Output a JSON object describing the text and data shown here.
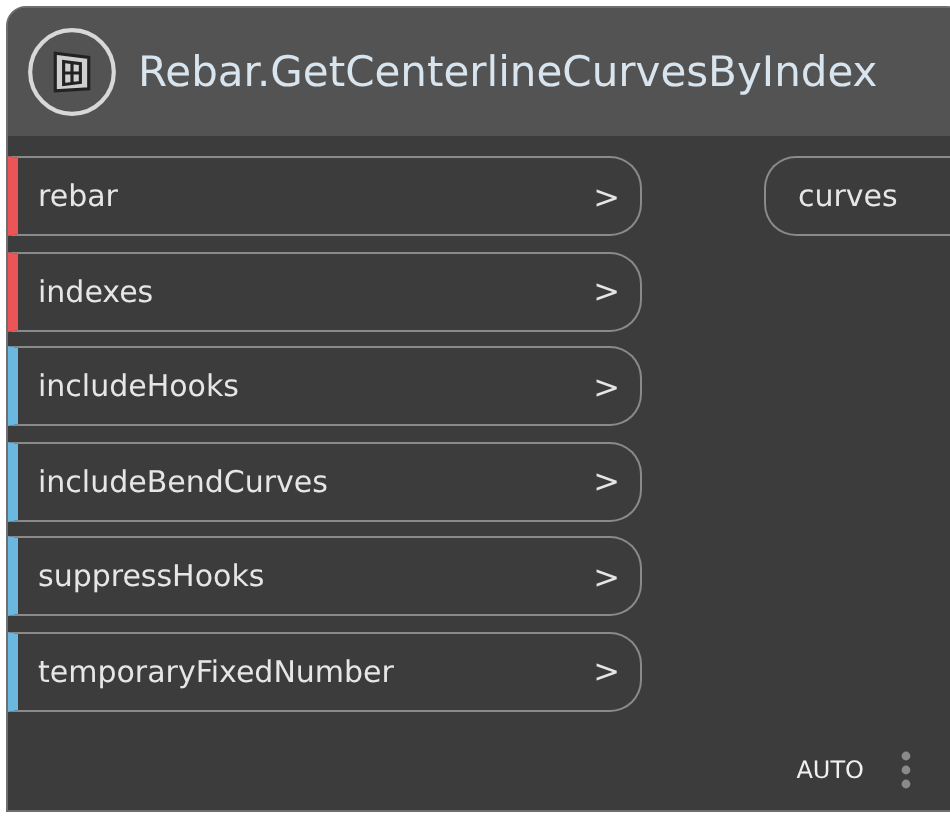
{
  "node": {
    "title": "Rebar.GetCenterlineCurvesByIndex"
  },
  "inputs": [
    {
      "name": "rebar",
      "required": true,
      "arrow": ">"
    },
    {
      "name": "indexes",
      "required": true,
      "arrow": ">"
    },
    {
      "name": "includeHooks",
      "required": false,
      "arrow": ">"
    },
    {
      "name": "includeBendCurves",
      "required": false,
      "arrow": ">"
    },
    {
      "name": "suppressHooks",
      "required": false,
      "arrow": ">"
    },
    {
      "name": "temporaryFixedNumber",
      "required": false,
      "arrow": ">"
    }
  ],
  "outputs": [
    {
      "name": "curves"
    }
  ],
  "footer": {
    "lacing": "AUTO"
  }
}
